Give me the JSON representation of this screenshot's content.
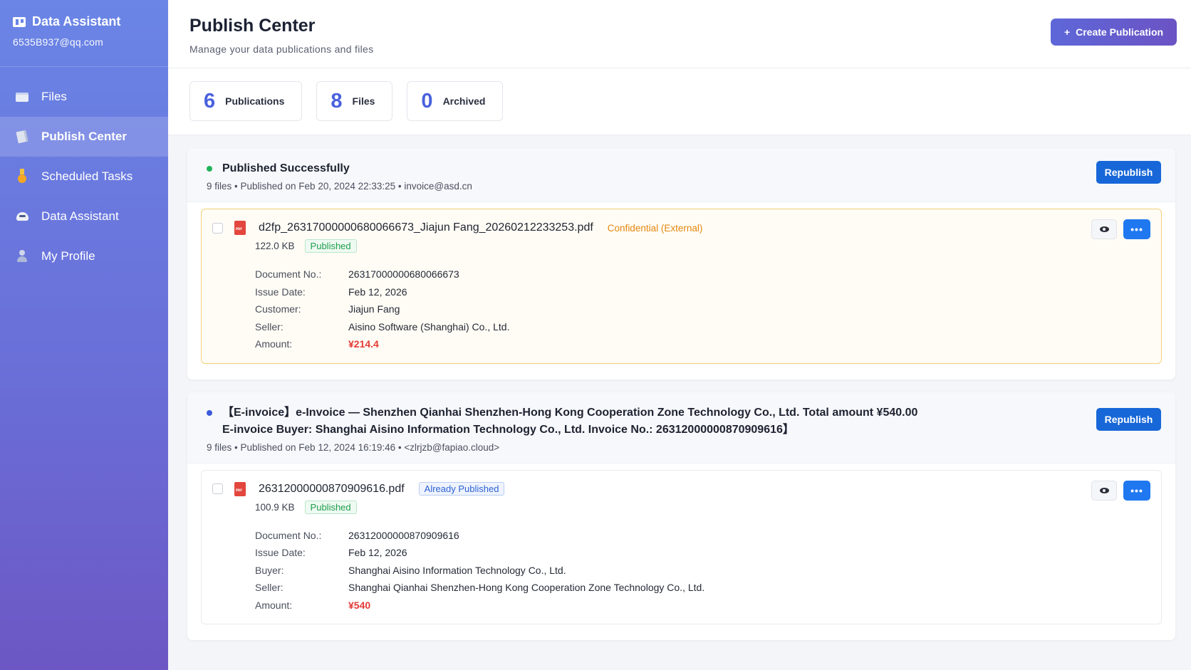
{
  "sidebar": {
    "app_name": "Data Assistant",
    "email": "6535B937@qq.com",
    "items": [
      {
        "label": "Files",
        "icon": "folder-icon"
      },
      {
        "label": "Publish Center",
        "icon": "document-icon",
        "active": true
      },
      {
        "label": "Scheduled Tasks",
        "icon": "medal-icon"
      },
      {
        "label": "Data Assistant",
        "icon": "robot-icon"
      },
      {
        "label": "My Profile",
        "icon": "user-icon"
      }
    ]
  },
  "header": {
    "title": "Publish Center",
    "subtitle": "Manage your data publications and files",
    "create_label": "Create Publication",
    "create_icon": "+"
  },
  "stats": [
    {
      "value": "6",
      "label": "Publications"
    },
    {
      "value": "8",
      "label": "Files"
    },
    {
      "value": "0",
      "label": "Archived"
    }
  ],
  "publications": [
    {
      "status_color": "#22b35a",
      "title_line1": "Published Successfully",
      "title_line2": "",
      "meta": "9 files  •  Published on Feb 20, 2024 22:33:25  •  invoice@asd.cn",
      "republish_label": "Republish",
      "file": {
        "name": "d2fp_26317000000680066673_Jiajun Fang_20260212233253.pdf",
        "tag": "Confidential (External)",
        "size": "122.0 KB",
        "status": "Published",
        "more_label": "•••",
        "details": [
          {
            "label": "Document No.:",
            "value": "26317000000680066673"
          },
          {
            "label": "Issue Date:",
            "value": "Feb 12, 2026"
          },
          {
            "label": "Customer:",
            "value": "Jiajun Fang"
          },
          {
            "label": "Seller:",
            "value": "Aisino Software (Shanghai) Co., Ltd."
          },
          {
            "label": "Amount:",
            "value": "¥214.4"
          }
        ]
      }
    },
    {
      "status_color": "#3d5bd9",
      "title_line1": "【E-invoice】e-Invoice — Shenzhen Qianhai Shenzhen-Hong Kong Cooperation Zone Technology Co., Ltd.   Total amount ¥540.00",
      "title_line2": "E-invoice Buyer: Shanghai Aisino Information Technology Co., Ltd.   Invoice No.: 26312000000870909616】",
      "meta": "9 files  •  Published on Feb 12, 2024 16:19:46  •  <zlrjzb@fapiao.cloud>",
      "republish_label": "Republish",
      "file": {
        "name": "26312000000870909616.pdf",
        "tag": "Already Published",
        "size": "100.9 KB",
        "status": "Published",
        "more_label": "•••",
        "details": [
          {
            "label": "Document No.:",
            "value": "26312000000870909616"
          },
          {
            "label": "Issue Date:",
            "value": "Feb 12, 2026"
          },
          {
            "label": "Buyer:",
            "value": "Shanghai Aisino Information Technology Co., Ltd."
          },
          {
            "label": "Seller:",
            "value": "Shanghai Qianhai Shenzhen-Hong Kong Cooperation Zone Technology Co., Ltd."
          },
          {
            "label": "Amount:",
            "value": "¥540"
          }
        ]
      }
    }
  ]
}
